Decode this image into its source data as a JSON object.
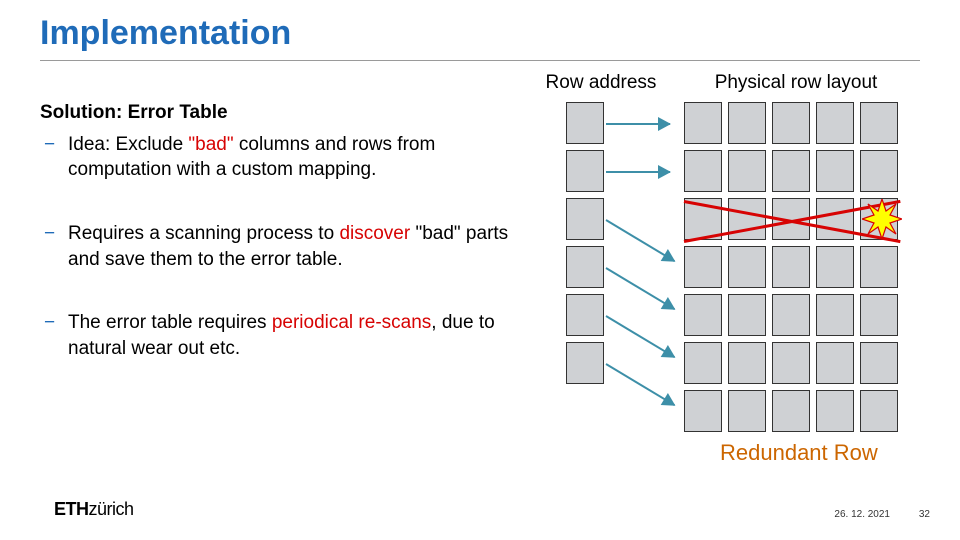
{
  "title": "Implementation",
  "section_heading": "Solution: Error Table",
  "bullets": {
    "b1_pre": "Idea: Exclude ",
    "b1_mid": "\"bad\"",
    "b1_post": " columns and rows from computation with a custom mapping.",
    "b2_pre": "Requires a scanning process to ",
    "b2_mid": "discover",
    "b2_post": " \"bad\" parts and save them to the error table.",
    "b3_pre": "The error table requires ",
    "b3_mid": "periodical re-scans",
    "b3_post": ", due to natural wear out etc."
  },
  "figure": {
    "label_left": "Row address",
    "label_right": "Physical row layout",
    "redundant_label": "Redundant Row"
  },
  "footer": {
    "logo_bold": "ETH",
    "logo_thin": "zürich",
    "date": "26. 12. 2021",
    "page": "32"
  },
  "colors": {
    "accent": "#1f6bb8",
    "red": "#d70303",
    "orange": "#cc6600",
    "arrow": "#3d8fa8",
    "grid": "#cfd1d4"
  }
}
